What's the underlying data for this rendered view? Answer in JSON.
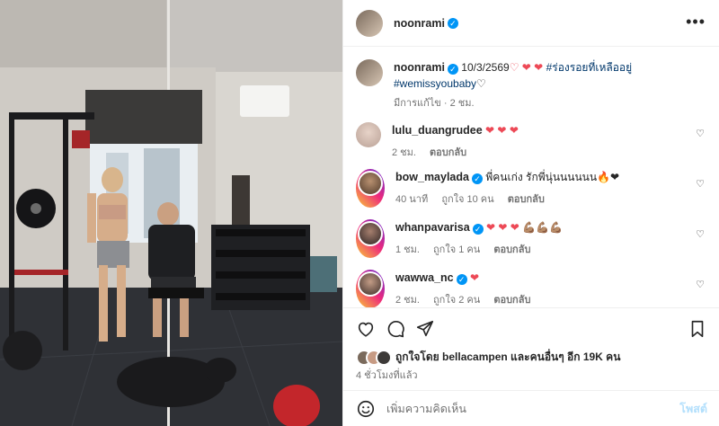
{
  "post": {
    "author": "noonrami",
    "caption_date": "10/3/2569",
    "caption_hearts": "♡ ❤ ❤",
    "hashtag1": "#ร่องรอยที่เหลืออยู่",
    "hashtag2": "#wemissyoubaby",
    "caption_tail_heart": "♡",
    "meta": "มีการแก้ไข · 2 ชม."
  },
  "comments": [
    {
      "user": "lulu_duangrudee",
      "verified": false,
      "text": "❤ ❤ ❤",
      "time": "2 ชม.",
      "likes": "",
      "reply": "ตอบกลับ"
    },
    {
      "user": "bow_maylada",
      "verified": true,
      "text": "พี่คนเก่ง รักพี่นุ่นนนนนน🔥❤",
      "time": "40 นาที",
      "likes": "ถูกใจ 10 คน",
      "reply": "ตอบกลับ"
    },
    {
      "user": "whanpavarisa",
      "verified": true,
      "text": "❤ ❤ ❤ 💪🏽💪🏽💪🏽",
      "time": "1 ชม.",
      "likes": "ถูกใจ 1 คน",
      "reply": "ตอบกลับ"
    },
    {
      "user": "wawwa_nc",
      "verified": true,
      "text": "❤",
      "time": "2 ชม.",
      "likes": "ถูกใจ 2 คน",
      "reply": "ตอบกลับ"
    }
  ],
  "likes_text": "ถูกใจโดย bellacampen และคนอื่นๆ อีก 19K คน",
  "posted_time": "4 ชั่วโมงที่แล้ว",
  "comment_input": {
    "placeholder": "เพิ่มความคิดเห็น",
    "post_label": "โพสต์"
  },
  "colors": {
    "link": "#00376b",
    "verified": "#0095f6",
    "heart": "#ed4956",
    "muted": "#737373"
  }
}
